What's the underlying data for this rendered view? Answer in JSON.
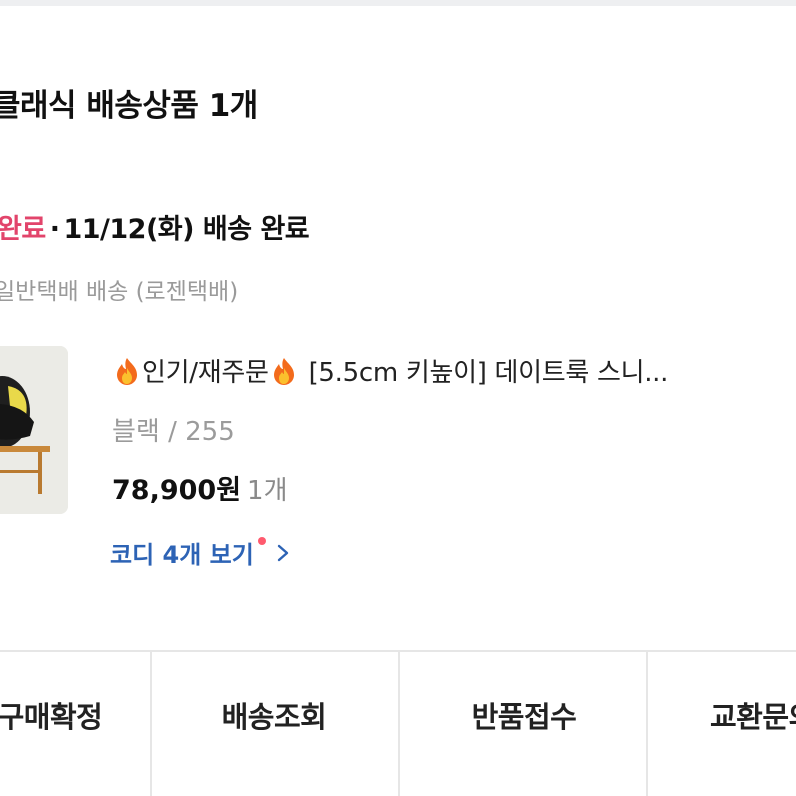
{
  "order_group": {
    "seller_title": "클래식 배송상품 1개",
    "status_label": "완료",
    "separator": "·",
    "delivery_date": "11/12(화) 배송 완료",
    "carrier_info": "일반택배 배송 (로젠택배)"
  },
  "product": {
    "name_badge": "인기/재주문",
    "name_text": "[5.5cm 키높이] 데이트룩 스니...",
    "option": "블랙 / 255",
    "price": "78,900원",
    "quantity": "1개",
    "fire_icon": "fire-emoji-icon",
    "thumbnail": "product-thumbnail"
  },
  "codi_link": {
    "label": "코디 4개 보기",
    "has_new_dot": true,
    "dot_color": "#ff5a6e",
    "link_color": "#2d63b5"
  },
  "actions": [
    {
      "label": "구매확정"
    },
    {
      "label": "배송조회"
    },
    {
      "label": "반품접수"
    },
    {
      "label": "교환문의"
    }
  ],
  "colors": {
    "status": "#e2446b",
    "text": "#222222",
    "muted": "#9a9a9a",
    "divider": "#e6e6e6"
  }
}
